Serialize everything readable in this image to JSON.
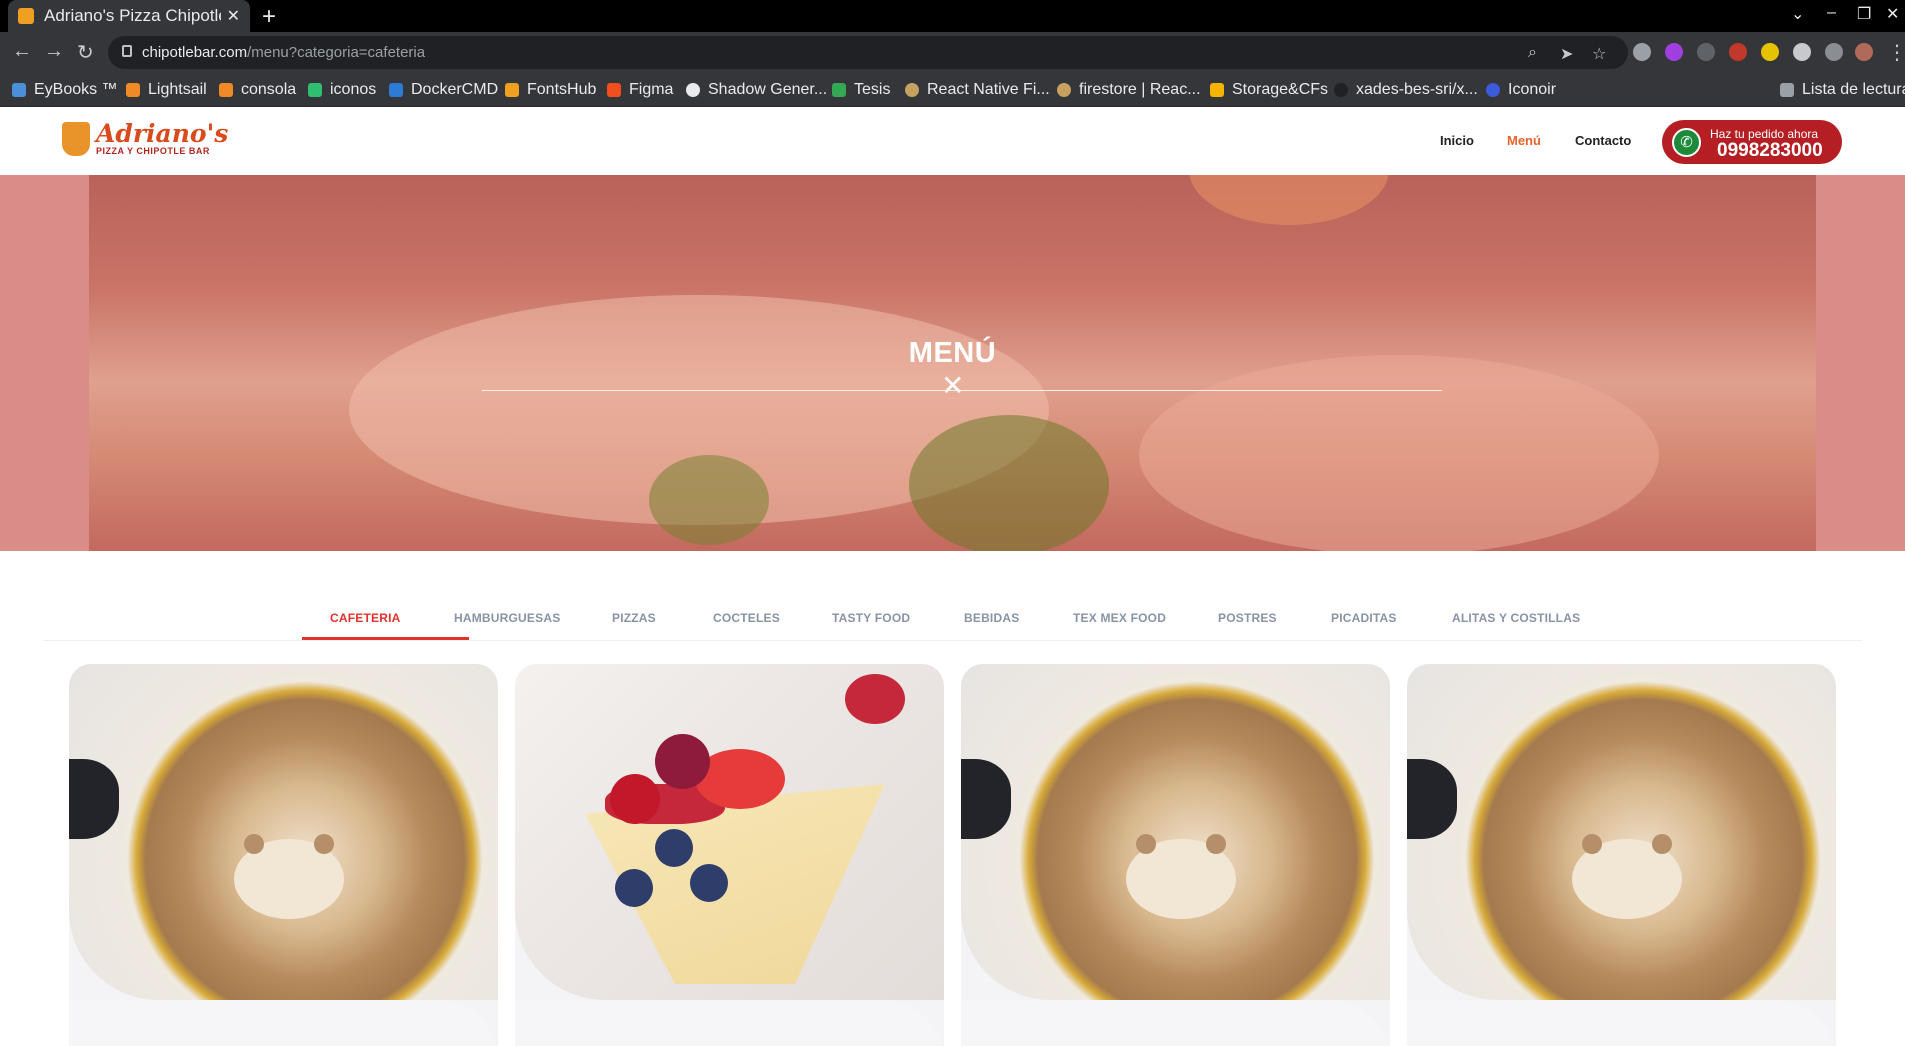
{
  "browser": {
    "tab_title": "Adriano's Pizza Chipotle Ba",
    "url_host": "chipotlebar.com",
    "url_path": "/menu?categoria=cafeteria",
    "bookmarks": [
      "EyBooks ™",
      "Lightsail",
      "consola",
      "iconos",
      "DockerCMD",
      "FontsHub",
      "Figma",
      "Shadow Gener...",
      "Tesis",
      "React Native Fi...",
      "firestore | Reac...",
      "Storage&CFs",
      "xades-bes-sri/x...",
      "Iconoir"
    ],
    "reading_list": "Lista de lectura"
  },
  "site": {
    "logo_brand": "Adriano's",
    "logo_sub": "PIZZA Y CHIPOTLE BAR",
    "nav": [
      "Inicio",
      "Menú",
      "Contacto"
    ],
    "order_line1": "Haz tu pedido ahora",
    "order_phone": "0998283000"
  },
  "hero": {
    "title": "MENÚ"
  },
  "categories": [
    "CAFETERIA",
    "HAMBURGUESAS",
    "PIZZAS",
    "COCTELES",
    "TASTY FOOD",
    "BEBIDAS",
    "TEX MEX FOOD",
    "POSTRES",
    "PICADITAS",
    "ALITAS Y COSTILLAS"
  ],
  "active_category": "CAFETERIA",
  "colors": {
    "accent_red": "#e0332b",
    "nav_active": "#e8642a",
    "order_button": "#b51f24",
    "phone_green": "#1d8a3a"
  },
  "icons": {
    "close": "close-icon",
    "phone": "phone-icon"
  }
}
